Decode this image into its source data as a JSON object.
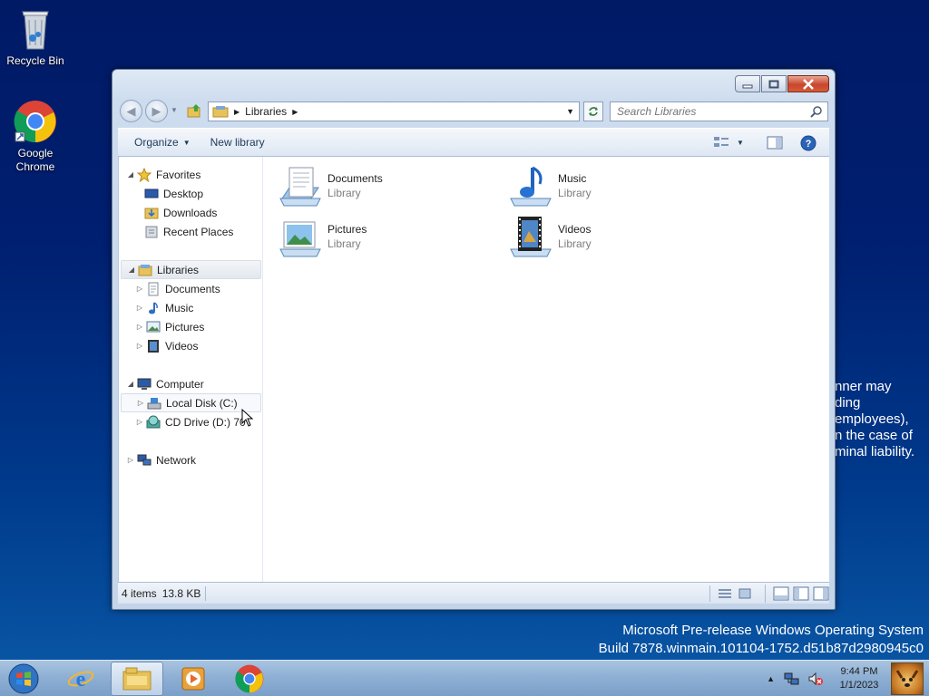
{
  "desktop": {
    "icons": [
      {
        "label": "Recycle Bin"
      },
      {
        "label": "Google Chrome"
      }
    ],
    "legal_lines": [
      "nner may",
      "ding",
      "employees),",
      "n the case of",
      "minal liability."
    ],
    "build_lines": [
      "Microsoft Pre-release Windows Operating System",
      "Build 7878.winmain.101104-1752.d51b87d2980945c0"
    ]
  },
  "window": {
    "address": {
      "crumbs": [
        "Libraries"
      ]
    },
    "search": {
      "placeholder": "Search Libraries"
    },
    "toolbar": {
      "organize": "Organize",
      "new_library": "New library"
    },
    "nav_tree": {
      "favorites": {
        "label": "Favorites",
        "items": [
          "Desktop",
          "Downloads",
          "Recent Places"
        ]
      },
      "libraries": {
        "label": "Libraries",
        "items": [
          "Documents",
          "Music",
          "Pictures",
          "Videos"
        ]
      },
      "computer": {
        "label": "Computer",
        "items": [
          "Local Disk (C:)",
          "CD Drive (D:) 70"
        ]
      },
      "network": {
        "label": "Network"
      }
    },
    "libraries": [
      {
        "name": "Documents",
        "type": "Library",
        "icon": "documents-icon"
      },
      {
        "name": "Music",
        "type": "Library",
        "icon": "music-icon"
      },
      {
        "name": "Pictures",
        "type": "Library",
        "icon": "pictures-icon"
      },
      {
        "name": "Videos",
        "type": "Library",
        "icon": "videos-icon"
      }
    ],
    "status": {
      "item_count": "4 items",
      "size": "13.8 KB"
    }
  },
  "taskbar": {
    "apps": [
      "Internet Explorer",
      "Windows Explorer",
      "Windows Media Player",
      "Google Chrome"
    ],
    "clock": {
      "time": "9:44 PM",
      "date": "1/1/2023"
    }
  },
  "colors": {
    "accent": "#1e395b",
    "close_button": "#c9462c",
    "desktop_bg": "#001f70"
  }
}
